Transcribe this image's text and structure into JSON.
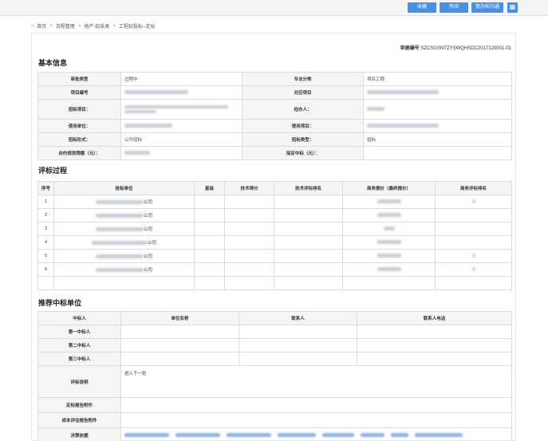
{
  "toolbar": {
    "buttons": [
      {
        "label": "收藏"
      },
      {
        "label": "传阅"
      },
      {
        "label": "督办和沟通"
      }
    ],
    "grid_icon": "grid-icon"
  },
  "breadcrumb": {
    "items": [
      "首页",
      "流程管理",
      "地产-招采类",
      "工程招投标--定标"
    ]
  },
  "doc_number": {
    "label": "单据编号",
    "value": "SZCSGSNTZYSWQHSDC2017120001-01"
  },
  "basic": {
    "title": "基本信息",
    "rows": [
      [
        "审批类型",
        "过程中",
        "专业分类",
        "项目工程"
      ],
      [
        "项目编号",
        "",
        "对应项目",
        ""
      ],
      [
        "招标项目：",
        "",
        "经办人：",
        ""
      ],
      [
        "使用单位：",
        "",
        "使用项目：",
        ""
      ],
      [
        "招标形式：",
        "公开招标",
        "招标类型：",
        "招标"
      ],
      [
        "合约规划限额（元）：",
        "",
        "拟定中标（元）：",
        ""
      ]
    ]
  },
  "eval": {
    "title": "评标过程",
    "headers": [
      "序号",
      "投标单位",
      "星级",
      "技术得分",
      "技术评标排名",
      "商务报价（最终报价）",
      "商务评标排名"
    ],
    "rows": [
      {
        "no": "1",
        "unit": "公司"
      },
      {
        "no": "2",
        "unit": "公司"
      },
      {
        "no": "3",
        "unit": "公司"
      },
      {
        "no": "4",
        "unit": "公司"
      },
      {
        "no": "5",
        "unit": "公司"
      },
      {
        "no": "6",
        "unit": "公司"
      }
    ]
  },
  "recommend": {
    "title": "推荐中标单位",
    "headers": [
      "中标人",
      "单位名称",
      "联系人",
      "联系人电话"
    ],
    "rows": [
      "第一中标人",
      "第二中标人",
      "第三中标人"
    ],
    "eval_label": "评标说明",
    "eval_text": "进入下一轮",
    "report_label": "定标报告附件",
    "cost_label": "成本评估报告附件",
    "basis_label": "决策依据"
  },
  "colors": {
    "accent": "#4a90e2",
    "label_bg": "#f5f5f5",
    "border": "#dcdcdc"
  }
}
